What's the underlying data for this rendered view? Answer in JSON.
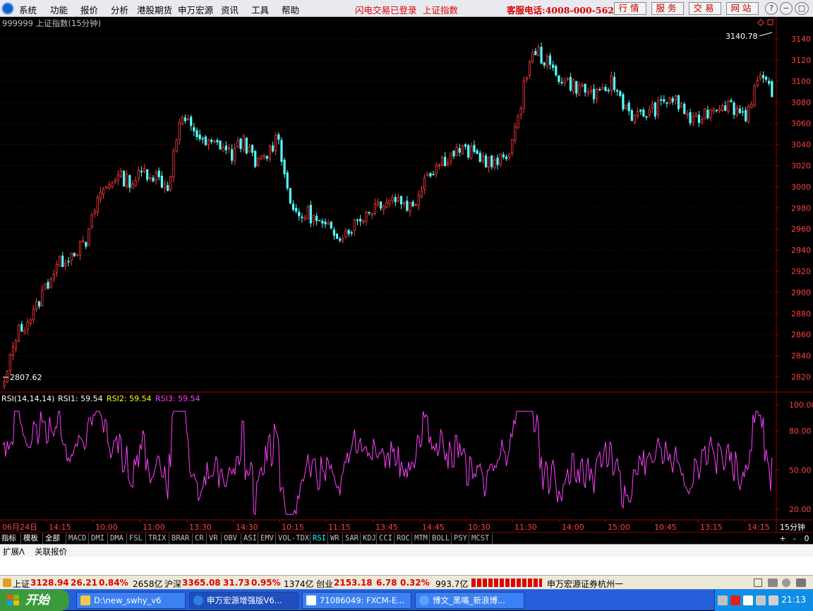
{
  "menu": {
    "items": [
      "系统",
      "功能",
      "报价",
      "分析",
      "港股期货",
      "申万宏源",
      "资讯",
      "工具",
      "帮助"
    ],
    "status_login": "闪电交易已登录",
    "status_index": "上证指数",
    "hotline": "客服电话:4008-000-562",
    "buttons": [
      "行情",
      "服务",
      "交易",
      "网站"
    ],
    "window_controls": [
      "?",
      "−",
      "□",
      "×"
    ]
  },
  "chart_header": {
    "title": "999999 上证指数(15分钟)"
  },
  "rsi_header": {
    "label": "RSI(14,14,14)",
    "rsi1": "RSI1: 59.54",
    "rsi2": "RSI2: 59.54",
    "rsi3": "RSI3: 59.54"
  },
  "annotations": {
    "high": "3140.78",
    "low": "2807.62"
  },
  "xaxis": {
    "labels": [
      "06月24日",
      "14:15",
      "10:00",
      "11:00",
      "13:30",
      "14:30",
      "10:15",
      "11:15",
      "13:45",
      "14:45",
      "10:30",
      "11:30",
      "14:00",
      "15:00",
      "10:45",
      "13:15",
      "14:15"
    ],
    "period_label": "15分钟"
  },
  "indicator_tabs": [
    "指标",
    "模板",
    "全部",
    "MACD",
    "DMI",
    "DMA",
    "FSL",
    "TRIX",
    "BRAR",
    "CR",
    "VR",
    "OBV",
    "ASI",
    "EMV",
    "VOL-TDX",
    "RSI",
    "WR",
    "SAR",
    "KDJ",
    "CCI",
    "ROC",
    "MTM",
    "BOLL",
    "PSY",
    "MCST"
  ],
  "active_tab": "RSI",
  "tab_controls": [
    "+",
    "-",
    "0"
  ],
  "info_tabs": [
    "扩展Λ",
    "关联报价"
  ],
  "status": {
    "sh_label": "上证",
    "sh_value": "3128.94",
    "sh_change": "26.21",
    "sh_pct": "0.84%",
    "sh_vol": "2658亿",
    "hs_label": "沪深",
    "hs_value": "3365.08",
    "hs_change": "31.73",
    "hs_pct": "0.95%",
    "hs_vol": "1374亿",
    "cy_label": "创业",
    "cy_value": "2153.18",
    "cy_change": "6.78",
    "cy_pct": "0.32%",
    "cy_vol": "993.7亿",
    "broker": "申万宏源证券杭州一"
  },
  "taskbar": {
    "start": "开始",
    "tasks": [
      "D:\\new_swhy_v6",
      "申万宏源增强版V6...",
      "71086049: FXCM-E...",
      "博文_黑嘴_新浪博..."
    ],
    "clock": "21:13"
  },
  "colors": {
    "up": "#ff3b3b",
    "down": "#54ffff",
    "rsi": "#ff40ff",
    "axis": "#a00000",
    "grid": "#7a0000",
    "price_label": "#ff4040",
    "rsi1": "#ffffff",
    "rsi2": "#ffff00",
    "rsi3": "#ff40ff"
  },
  "chart_data": [
    {
      "type": "candlestick",
      "title": "999999 上证指数(15分钟)",
      "ylim": [
        2807.62,
        3140.78
      ],
      "yticks": [
        2820,
        2840,
        2860,
        2880,
        2900,
        2920,
        2940,
        2960,
        2980,
        3000,
        3020,
        3040,
        3060,
        3080,
        3100,
        3120,
        3140
      ],
      "x_count": 264,
      "close_anchors": [
        [
          0,
          2812
        ],
        [
          4,
          2860
        ],
        [
          10,
          2880
        ],
        [
          14,
          2905
        ],
        [
          18,
          2925
        ],
        [
          24,
          2940
        ],
        [
          28,
          2945
        ],
        [
          32,
          2990
        ],
        [
          38,
          3010
        ],
        [
          44,
          3005
        ],
        [
          48,
          3015
        ],
        [
          52,
          3010
        ],
        [
          56,
          3000
        ],
        [
          60,
          3060
        ],
        [
          64,
          3060
        ],
        [
          68,
          3040
        ],
        [
          74,
          3040
        ],
        [
          78,
          3030
        ],
        [
          82,
          3045
        ],
        [
          86,
          3020
        ],
        [
          90,
          3030
        ],
        [
          94,
          3050
        ],
        [
          96,
          3010
        ],
        [
          100,
          2970
        ],
        [
          104,
          2975
        ],
        [
          110,
          2960
        ],
        [
          116,
          2955
        ],
        [
          122,
          2970
        ],
        [
          128,
          2985
        ],
        [
          134,
          2990
        ],
        [
          140,
          2980
        ],
        [
          144,
          3010
        ],
        [
          150,
          3025
        ],
        [
          156,
          3035
        ],
        [
          162,
          3030
        ],
        [
          168,
          3020
        ],
        [
          172,
          3030
        ],
        [
          176,
          3060
        ],
        [
          178,
          3100
        ],
        [
          182,
          3130
        ],
        [
          188,
          3110
        ],
        [
          192,
          3100
        ],
        [
          196,
          3095
        ],
        [
          200,
          3090
        ],
        [
          204,
          3085
        ],
        [
          208,
          3100
        ],
        [
          212,
          3080
        ],
        [
          216,
          3065
        ],
        [
          220,
          3070
        ],
        [
          224,
          3075
        ],
        [
          228,
          3085
        ],
        [
          232,
          3075
        ],
        [
          236,
          3060
        ],
        [
          240,
          3070
        ],
        [
          246,
          3080
        ],
        [
          250,
          3075
        ],
        [
          254,
          3068
        ],
        [
          258,
          3100
        ],
        [
          262,
          3095
        ],
        [
          264,
          3090
        ]
      ]
    },
    {
      "type": "line",
      "title": "RSI(14,14,14)",
      "ylim": [
        14,
        100
      ],
      "yticks": [
        20,
        50,
        80,
        100
      ],
      "series": [
        {
          "name": "RSI1",
          "last": 59.54
        },
        {
          "name": "RSI2",
          "last": 59.54
        },
        {
          "name": "RSI3",
          "last": 59.54
        }
      ]
    }
  ]
}
